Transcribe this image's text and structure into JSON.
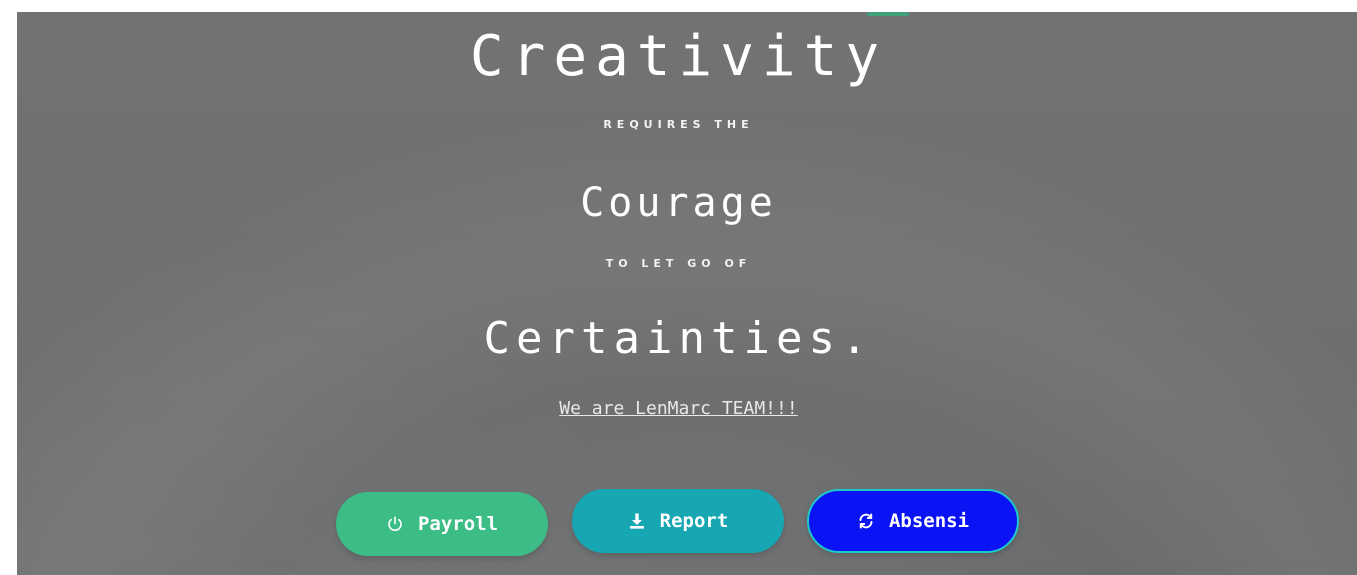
{
  "hero": {
    "line1": "Creativity",
    "line2": "REQUIRES THE",
    "line3": "Courage",
    "line4": "TO LET GO OF",
    "line5": "Certainties.",
    "team_link": "We are LenMarc TEAM!!!"
  },
  "buttons": {
    "payroll": {
      "label": "Payroll",
      "icon": "power-icon",
      "color": "#3cbd86"
    },
    "report": {
      "label": "Report",
      "icon": "download-icon",
      "color": "#16a7b3"
    },
    "absensi": {
      "label": "Absensi",
      "icon": "refresh-icon",
      "color": "#0a13f3"
    }
  }
}
